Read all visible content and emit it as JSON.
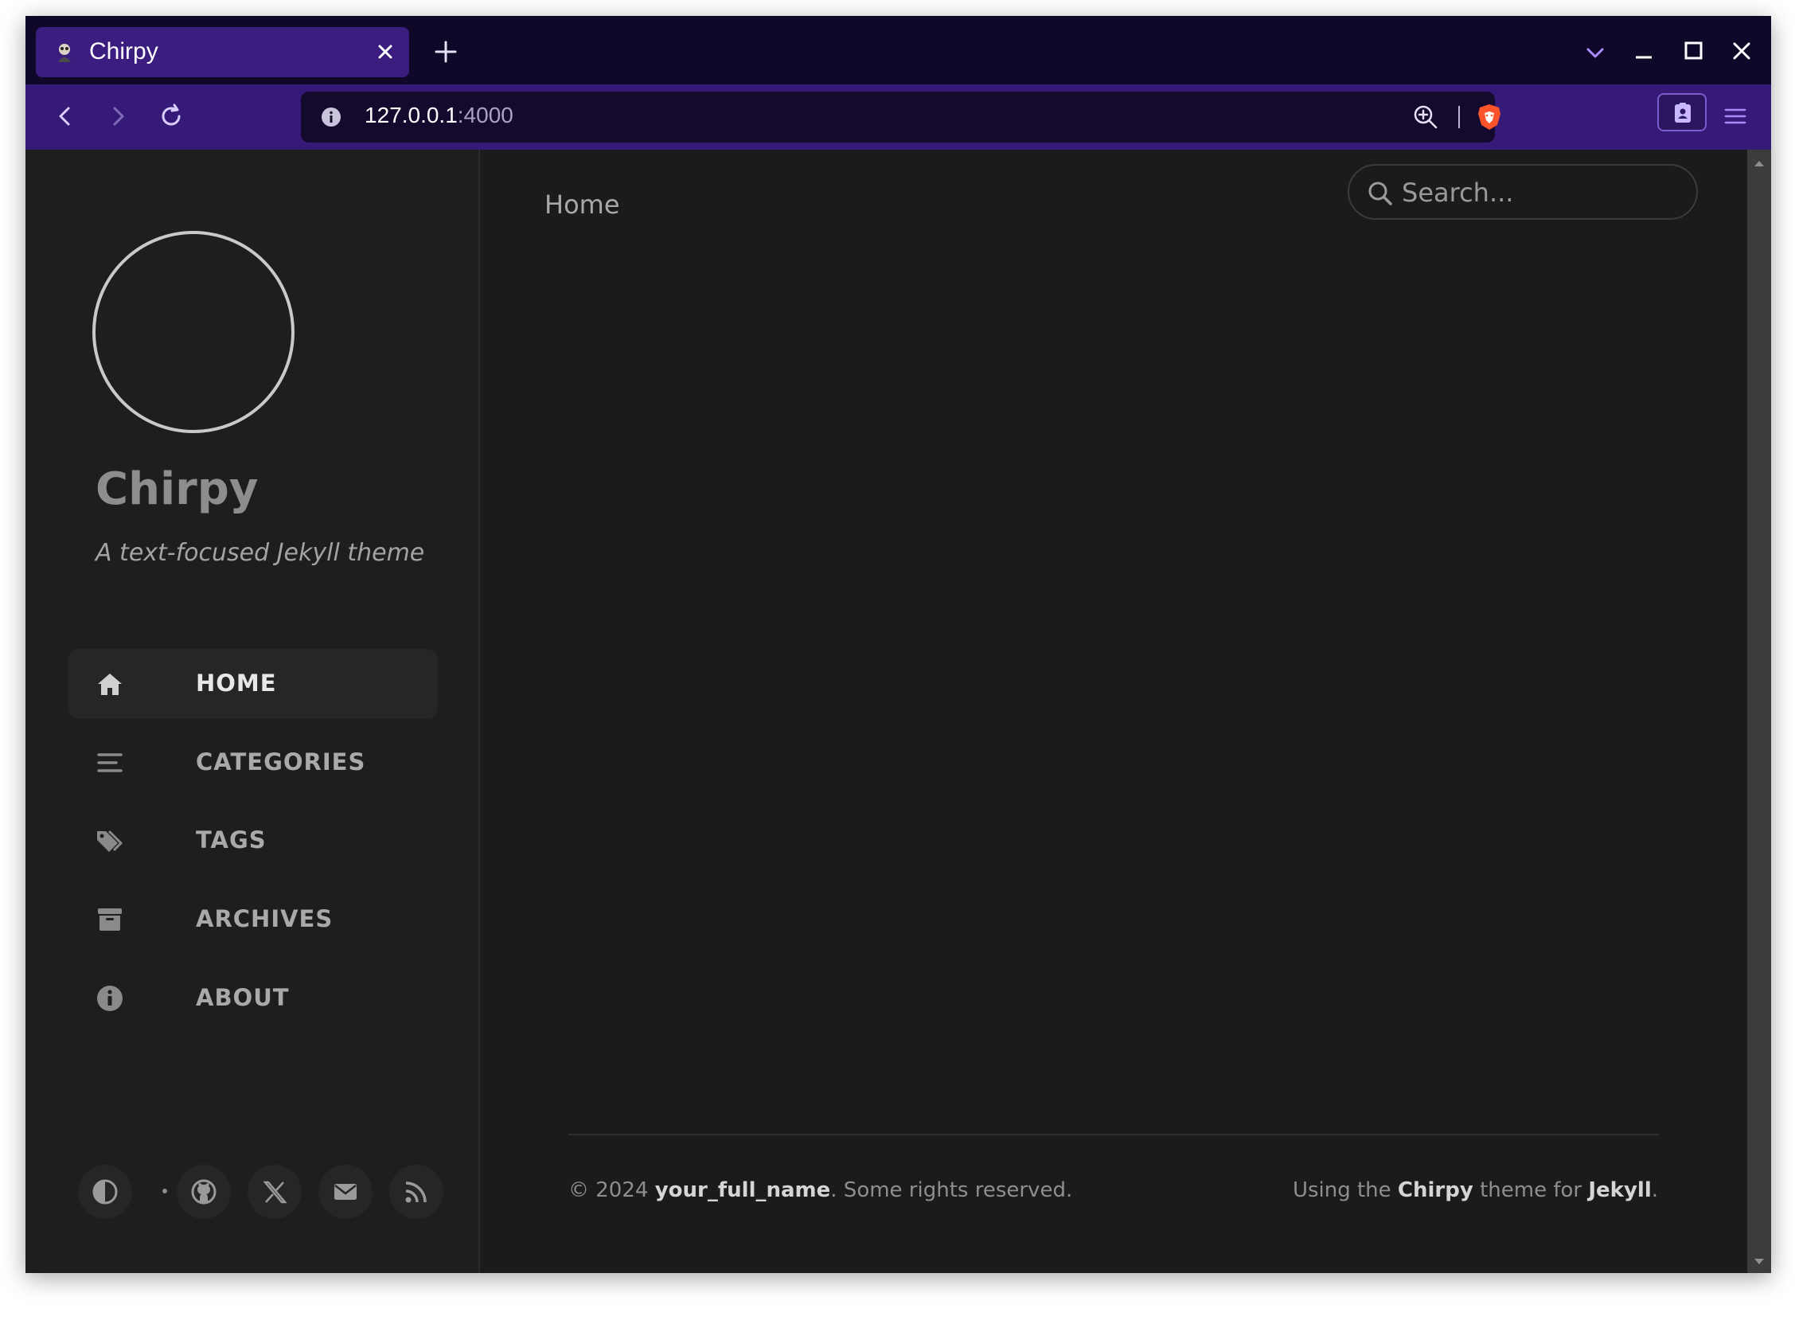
{
  "browser": {
    "tab_title": "Chirpy",
    "url_host": "127.0.0.1",
    "url_port": ":4000"
  },
  "sidebar": {
    "title": "Chirpy",
    "subtitle": "A text-focused Jekyll theme",
    "nav": [
      {
        "label": "HOME",
        "icon": "home-icon",
        "active": true
      },
      {
        "label": "CATEGORIES",
        "icon": "list-icon",
        "active": false
      },
      {
        "label": "TAGS",
        "icon": "tags-icon",
        "active": false
      },
      {
        "label": "ARCHIVES",
        "icon": "archive-icon",
        "active": false
      },
      {
        "label": "ABOUT",
        "icon": "info-icon",
        "active": false
      }
    ],
    "social": [
      "theme-toggle-icon",
      "github-icon",
      "x-icon",
      "email-icon",
      "rss-icon"
    ]
  },
  "main": {
    "breadcrumb": "Home",
    "search_placeholder": "Search..."
  },
  "footer": {
    "copyright_prefix": "© 2024 ",
    "owner": "your_full_name",
    "copyright_suffix": ". Some rights reserved.",
    "using_prefix": "Using the ",
    "theme_name": "Chirpy",
    "using_middle": " theme for ",
    "engine": "Jekyll",
    "using_suffix": "."
  },
  "colors": {
    "tabstrip": "#0f0828",
    "toolbar": "#361a78",
    "page_bg": "#1b1b1e",
    "sidebar_bg": "#1e1e1e"
  }
}
